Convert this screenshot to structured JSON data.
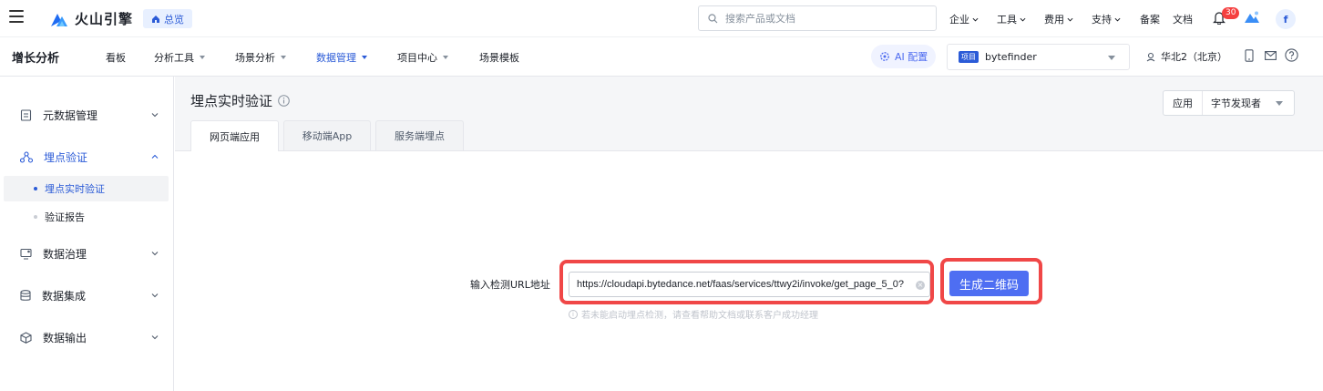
{
  "topbar": {
    "brand": "火山引擎",
    "overview_label": "总览",
    "search_placeholder": "搜索产品或文档",
    "menus": [
      "企业",
      "工具",
      "费用",
      "支持"
    ],
    "links": [
      "备案",
      "文档"
    ],
    "notification_count": "30",
    "avatar_letter": "f"
  },
  "subbar": {
    "product_title": "增长分析",
    "nav": [
      "看板",
      "分析工具",
      "场景分析",
      "数据管理",
      "项目中心",
      "场景模板"
    ],
    "ai_label": "AI 配置",
    "project_tag": "项目",
    "project_name": "bytefinder",
    "region": "华北2（北京）"
  },
  "sidebar": {
    "groups": [
      "元数据管理",
      "埋点验证",
      "数据治理",
      "数据集成",
      "数据输出"
    ],
    "sub_items": [
      "埋点实时验证",
      "验证报告"
    ]
  },
  "content": {
    "page_title": "埋点实时验证",
    "app_label": "应用",
    "app_value": "字节发现者",
    "tabs": [
      "网页端应用",
      "移动端App",
      "服务端埋点"
    ],
    "url_label": "输入检测URL地址",
    "url_value": "https://cloudapi.bytedance.net/faas/services/ttwy2i/invoke/get_page_5_0?",
    "generate_label": "生成二维码",
    "hint": "若未能启动埋点检测，请查看帮助文档或联系客户成功经理"
  },
  "colors": {
    "accent": "#2b5bd7",
    "button": "#4e6ef2",
    "highlight": "#f04747"
  }
}
